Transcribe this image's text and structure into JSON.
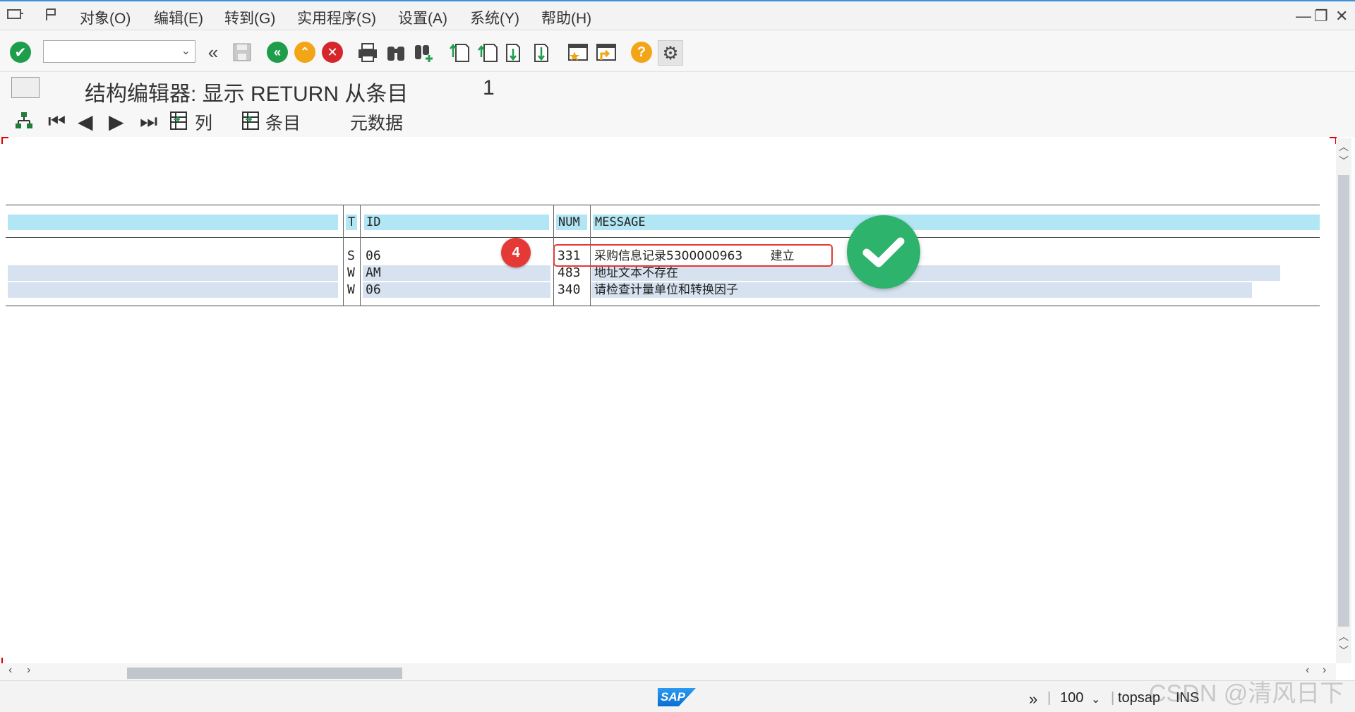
{
  "menu": {
    "items": [
      "对象(O)",
      "编辑(E)",
      "转到(G)",
      "实用程序(S)",
      "设置(A)",
      "系统(Y)",
      "帮助(H)"
    ]
  },
  "toolbar": {
    "command_value": "",
    "icons": [
      "enter-icon",
      "back-double-icon",
      "save-icon",
      "back-icon",
      "exit-icon",
      "cancel-icon",
      "print-icon",
      "find-icon",
      "find-next-icon",
      "first-page-icon",
      "prev-page-icon",
      "next-page-icon",
      "last-page-icon",
      "new-session-icon",
      "shortcut-icon",
      "help-icon",
      "customize-icon"
    ]
  },
  "title": {
    "text": "结构编辑器: 显示 RETURN 从条目",
    "number": "1"
  },
  "app_toolbar": {
    "columns_label": "列",
    "entries_label": "条目",
    "metadata_label": "元数据"
  },
  "table": {
    "headers": {
      "t": "T",
      "id": "ID",
      "num": "NUM",
      "message": "MESSAGE"
    },
    "rows": [
      {
        "t": "S",
        "id": "06",
        "num": "331",
        "message": "采购信息记录5300000963",
        "suffix": "建立"
      },
      {
        "t": "W",
        "id": "AM",
        "num": "483",
        "message": "地址文本不存在",
        "suffix": ""
      },
      {
        "t": "W",
        "id": "06",
        "num": "340",
        "message": "请检查计量单位和转换因子",
        "suffix": ""
      }
    ]
  },
  "annotation": {
    "marker": "4"
  },
  "status": {
    "logo": "SAP",
    "zoom": "100",
    "system": "topsap",
    "mode": "INS"
  },
  "watermark": "CSDN @清风日下",
  "colors": {
    "header_bg": "#b3e6f5",
    "row_alt": "#d6e2f0",
    "accent": "#e53935",
    "ok": "#2db36b"
  }
}
